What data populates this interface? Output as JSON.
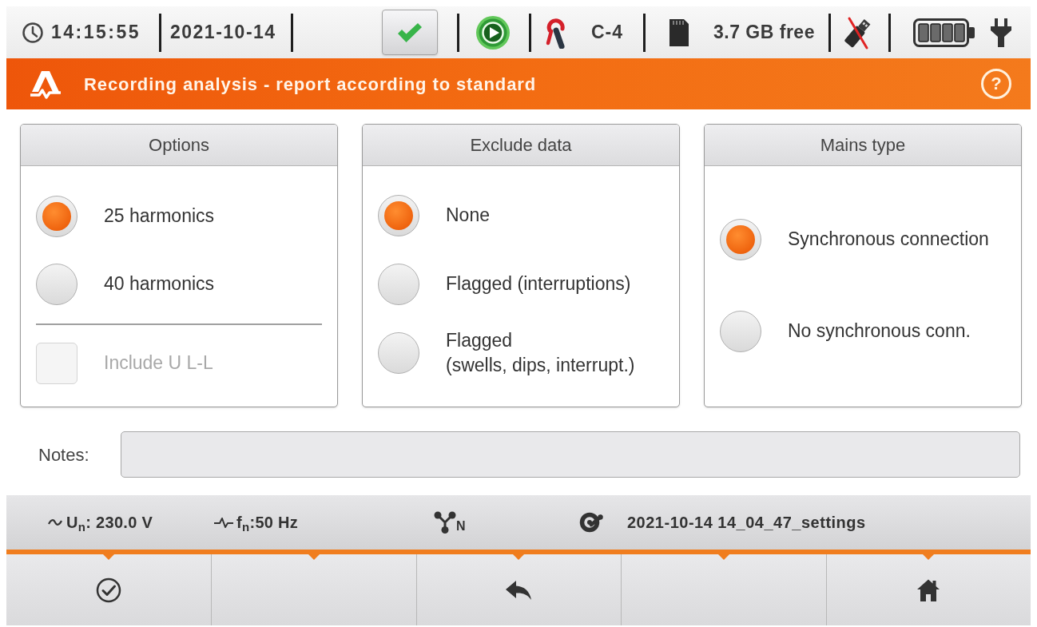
{
  "status_bar": {
    "time": "14:15:55",
    "date": "2021-10-14",
    "clamp": "C-4",
    "storage": "3.7 GB free"
  },
  "header": {
    "title": "Recording analysis - report according to standard",
    "help": "?"
  },
  "panels": [
    {
      "title": "Options",
      "items": [
        {
          "kind": "radio",
          "label": "25 harmonics",
          "selected": true,
          "disabled": false
        },
        {
          "kind": "radio",
          "label": "40 harmonics",
          "selected": false,
          "disabled": false
        },
        {
          "kind": "checkbox",
          "label": "Include U L-L",
          "checked": false,
          "disabled": true
        }
      ]
    },
    {
      "title": "Exclude data",
      "items": [
        {
          "kind": "radio",
          "label": "None",
          "selected": true,
          "disabled": false
        },
        {
          "kind": "radio",
          "label": "Flagged (interruptions)",
          "selected": false,
          "disabled": false
        },
        {
          "kind": "radio",
          "label": "Flagged\n(swells, dips, interrupt.)",
          "selected": false,
          "disabled": false
        }
      ]
    },
    {
      "title": "Mains type",
      "items": [
        {
          "kind": "radio",
          "label": "Synchronous connection",
          "selected": true,
          "disabled": false
        },
        {
          "kind": "radio",
          "label": "No synchronous conn.",
          "selected": false,
          "disabled": false
        }
      ]
    }
  ],
  "notes": {
    "label": "Notes:"
  },
  "info_bar": {
    "voltage": "U$_{n}$: 230.0 V",
    "frequency": "f$_{n}$:50 Hz",
    "network": "N",
    "settings_file": "2021-10-14 14_04_47_settings"
  },
  "toolbar": [
    {
      "kind": "confirm"
    },
    {
      "kind": "blank"
    },
    {
      "kind": "back"
    },
    {
      "kind": "blank"
    },
    {
      "kind": "home"
    }
  ]
}
